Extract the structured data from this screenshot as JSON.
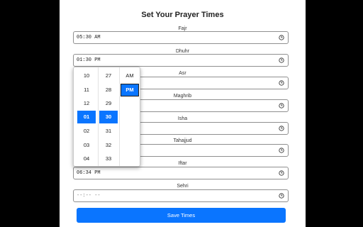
{
  "page": {
    "title": "Set Your Prayer Times"
  },
  "fields": [
    {
      "label": "Fajr",
      "value": "05:30 AM",
      "placeholder": false
    },
    {
      "label": "Dhuhr",
      "value": "01:30 PM",
      "placeholder": false
    },
    {
      "label": "Asr",
      "value": "",
      "placeholder": false
    },
    {
      "label": "Maghrib",
      "value": "",
      "placeholder": false
    },
    {
      "label": "Isha",
      "value": "",
      "placeholder": false
    },
    {
      "label": "Tahajjud",
      "value": "",
      "placeholder": false
    },
    {
      "label": "Iftar",
      "value": "06:34 PM",
      "placeholder": false
    },
    {
      "label": "Sehri",
      "value": "--:-- --",
      "placeholder": true
    }
  ],
  "picker": {
    "hours": [
      "10",
      "11",
      "12",
      "01",
      "02",
      "03",
      "04"
    ],
    "minutes": [
      "27",
      "28",
      "29",
      "30",
      "31",
      "32",
      "33"
    ],
    "ampm": [
      "AM",
      "PM"
    ],
    "selected_hour": "01",
    "selected_minute": "30",
    "selected_ampm": "PM"
  },
  "actions": {
    "save_label": "Save Times"
  },
  "colors": {
    "accent": "#0a75ff",
    "background": "#000000",
    "card": "#ffffff"
  },
  "icons": {
    "field_icon": "clock-icon"
  }
}
